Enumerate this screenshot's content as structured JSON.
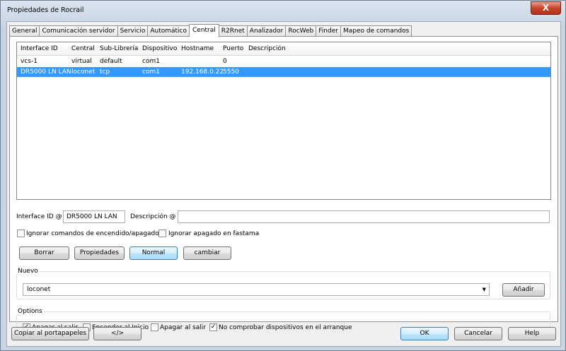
{
  "window": {
    "title": "Propiedades de Rocrail",
    "close_glyph": "X"
  },
  "tabs": [
    {
      "label": "General",
      "active": false
    },
    {
      "label": "Comunicación servidor",
      "active": false
    },
    {
      "label": "Servicio",
      "active": false
    },
    {
      "label": "Automático",
      "active": false
    },
    {
      "label": "Central",
      "active": true
    },
    {
      "label": "R2Rnet",
      "active": false
    },
    {
      "label": "Analizador",
      "active": false
    },
    {
      "label": "RocWeb",
      "active": false
    },
    {
      "label": "Finder",
      "active": false
    },
    {
      "label": "Mapeo de comandos",
      "active": false
    }
  ],
  "grid": {
    "columns": [
      "Interface ID",
      "Central",
      "Sub-Librería",
      "Dispositivo",
      "Hostname",
      "Puerto",
      "Descripción"
    ],
    "rows": [
      {
        "cells": [
          "vcs-1",
          "virtual",
          "default",
          "com1",
          "",
          "0",
          ""
        ],
        "selected": false
      },
      {
        "cells": [
          "DR5000 LN LAN",
          "loconet",
          "tcp",
          "com1",
          "192.168.0.22",
          "5550",
          ""
        ],
        "selected": true
      }
    ]
  },
  "form": {
    "interface_id_label": "Interface ID @",
    "interface_id_value": "DR5000 LN LAN",
    "descripcion_label": "Descripción @",
    "descripcion_value": "",
    "ignore_power_label": "Ignorar comandos de encendido/apagado",
    "ignore_power_checked": false,
    "ignore_fastclock_label": "Ignorar apagado en fastama",
    "ignore_fastclock_checked": false
  },
  "actions": {
    "borrar": "Borrar",
    "propiedades": "Propiedades",
    "normal": "Normal",
    "cambiar": "cambiar"
  },
  "nuevo": {
    "title": "Nuevo",
    "selected": "loconet",
    "add_label": "Añadir"
  },
  "options": {
    "title": "Options",
    "items": [
      {
        "label": "Apagar al salir",
        "checked": true
      },
      {
        "label": "Encender al Inicio",
        "checked": false
      },
      {
        "label": "Apagar al salir",
        "checked": false
      },
      {
        "label": "No comprobar dispositivos en el arranque",
        "checked": true
      }
    ]
  },
  "footer": {
    "copy": "Copiar al portapapeles",
    "code": "</>",
    "ok": "OK",
    "cancel": "Cancelar",
    "help": "Help"
  },
  "colors": {
    "selection": "#3399ff",
    "tab_active": "#ffffff"
  }
}
